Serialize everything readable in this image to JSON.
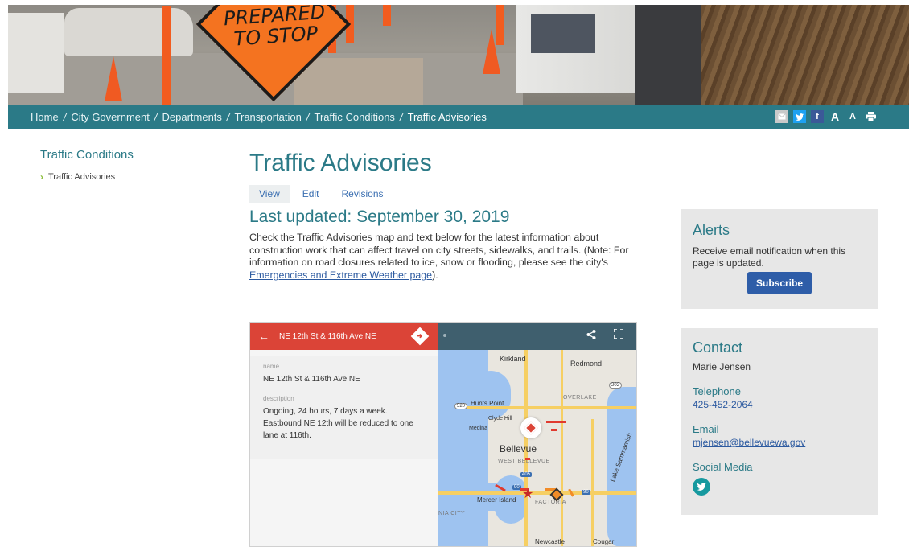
{
  "banner": {
    "sign_text": "PREPARED\nTO STOP"
  },
  "breadcrumb": {
    "items": [
      "Home",
      "City Government",
      "Departments",
      "Transportation",
      "Traffic Conditions",
      "Traffic Advisories"
    ],
    "separator": "/"
  },
  "tools": {
    "mail_icon": "mail-icon",
    "twitter_icon": "twitter-icon",
    "facebook_icon": "facebook-icon",
    "font_large": "A",
    "font_small": "A",
    "print_icon": "print-icon"
  },
  "sidebar": {
    "title": "Traffic Conditions",
    "items": [
      {
        "label": "Traffic Advisories"
      }
    ]
  },
  "main": {
    "title": "Traffic Advisories",
    "tabs": [
      {
        "label": "View"
      },
      {
        "label": "Edit"
      },
      {
        "label": "Revisions"
      }
    ],
    "updated": "Last updated: September 30, 2019",
    "intro_text": "Check the Traffic Advisories map and text below for the latest information about construction work that can affect travel on city streets, sidewalks, and trails. (Note: For information on road closures related to ice, snow or flooding, please see the city's ",
    "intro_link": "Emergencies and Extreme Weather page",
    "intro_end": ")."
  },
  "map": {
    "header_title": "NE 12th St & 116th Ave NE",
    "name_label": "name",
    "name_value": "NE 12th St & 116th Ave NE",
    "description_label": "description",
    "description_value": "Ongoing, 24 hours, 7 days a week. Eastbound NE 12th will be reduced to one lane at 116th.",
    "places": {
      "kirkland": "Kirkland",
      "redmond": "Redmond",
      "hunts_point": "Hunts Point",
      "overlake": "OVERLAKE",
      "clyde_hill": "Clyde Hill",
      "medina": "Medina",
      "bellevue": "Bellevue",
      "west_bellevue": "WEST BELLEVUE",
      "mercer_island": "Mercer Island",
      "factoria": "FACTORIA",
      "lake_sammamish": "Lake Sammamish",
      "newcastle": "Newcastle",
      "cougar": "Cougar",
      "nia_city": "NIA CITY"
    },
    "highway_labels": {
      "sr520": "520",
      "sr202": "202",
      "i405": "405",
      "i90a": "90",
      "i90b": "90"
    },
    "share_icon": "share-icon",
    "fullscreen_icon": "fullscreen-icon"
  },
  "alerts": {
    "title": "Alerts",
    "text": "Receive email notification when this page is updated.",
    "button": "Subscribe"
  },
  "contact": {
    "title": "Contact",
    "name": "Marie Jensen",
    "telephone_label": "Telephone",
    "telephone": "425-452-2064",
    "email_label": "Email",
    "email": "mjensen@bellevuewa.gov",
    "social_label": "Social Media"
  }
}
